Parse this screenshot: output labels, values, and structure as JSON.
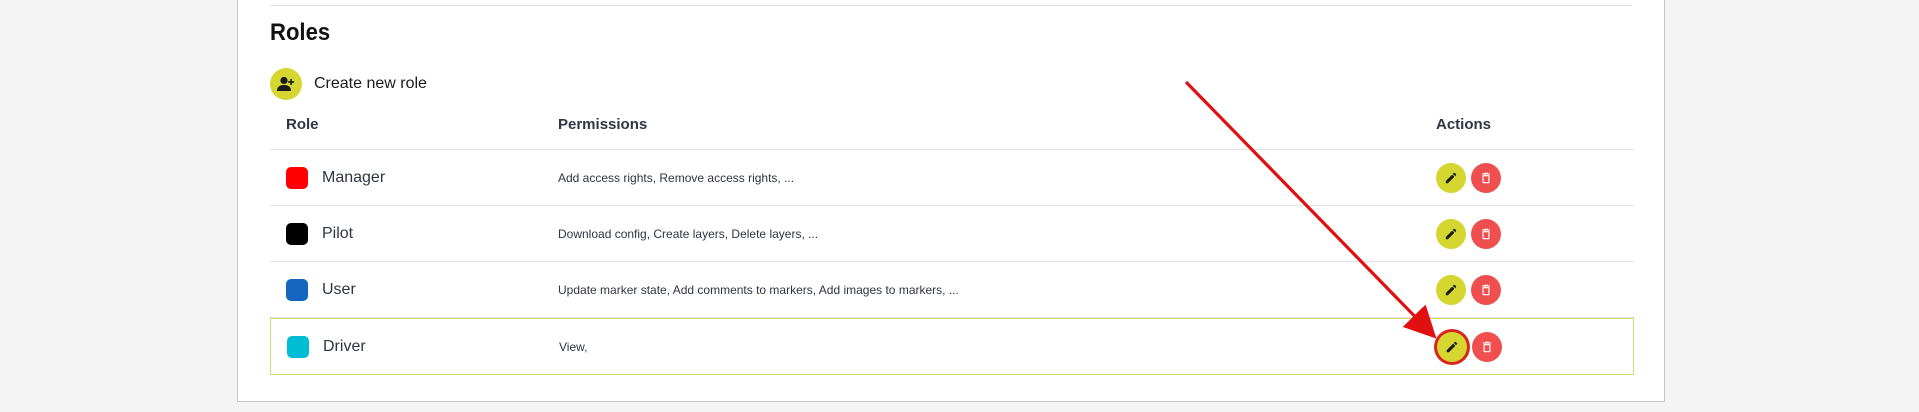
{
  "section": {
    "title": "Roles",
    "create_label": "Create new role"
  },
  "table": {
    "headers": {
      "role": "Role",
      "permissions": "Permissions",
      "actions": "Actions"
    },
    "rows": [
      {
        "name": "Manager",
        "color": "#ff0000",
        "permissions": "Add access rights, Remove access rights, ..."
      },
      {
        "name": "Pilot",
        "color": "#000000",
        "permissions": "Download config, Create layers, Delete layers, ..."
      },
      {
        "name": "User",
        "color": "#1565c0",
        "permissions": "Update marker state, Add comments to markers, Add images to markers, ..."
      },
      {
        "name": "Driver",
        "color": "#00bcd4",
        "permissions": "View,"
      }
    ]
  },
  "colors": {
    "accent": "#d6d630",
    "danger": "#ef4f4f",
    "annotation": "#e01010"
  },
  "icons": {
    "create": "add-user-icon",
    "edit": "pencil-icon",
    "delete": "trash-icon"
  }
}
